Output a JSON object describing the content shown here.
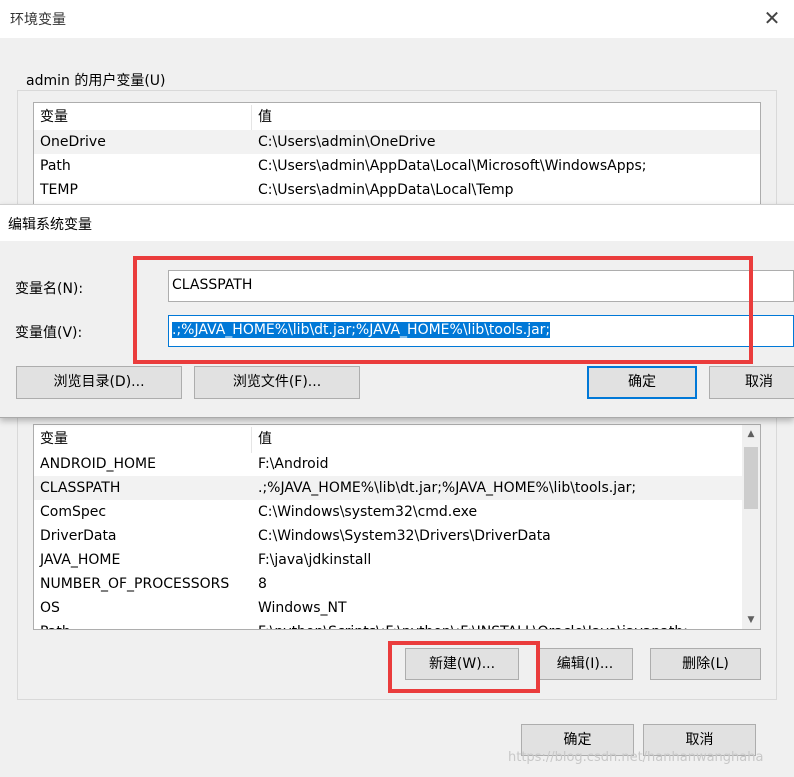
{
  "outer": {
    "title": "环境变量",
    "close_glyph": "✕",
    "user_group_label": "admin 的用户变量(U)",
    "ok_label": "确定",
    "cancel_label": "取消"
  },
  "user_vars": {
    "headers": [
      "变量",
      "值"
    ],
    "rows": [
      {
        "name": "OneDrive",
        "value": "C:\\Users\\admin\\OneDrive"
      },
      {
        "name": "Path",
        "value": "C:\\Users\\admin\\AppData\\Local\\Microsoft\\WindowsApps;"
      },
      {
        "name": "TEMP",
        "value": "C:\\Users\\admin\\AppData\\Local\\Temp"
      }
    ]
  },
  "sys_vars": {
    "headers": [
      "变量",
      "值"
    ],
    "rows": [
      {
        "name": " ANDROID_HOME",
        "value": "F:\\Android"
      },
      {
        "name": "CLASSPATH",
        "value": ".;%JAVA_HOME%\\lib\\dt.jar;%JAVA_HOME%\\lib\\tools.jar;"
      },
      {
        "name": "ComSpec",
        "value": "C:\\Windows\\system32\\cmd.exe"
      },
      {
        "name": "DriverData",
        "value": "C:\\Windows\\System32\\Drivers\\DriverData"
      },
      {
        "name": "JAVA_HOME",
        "value": "F:\\java\\jdkinstall"
      },
      {
        "name": "NUMBER_OF_PROCESSORS",
        "value": "8"
      },
      {
        "name": "OS",
        "value": "Windows_NT"
      },
      {
        "name": "Path",
        "value": "F:\\python\\Scripts\\;F:\\python\\;F:\\INSTALL\\Oracle\\Java\\javapath;..."
      }
    ],
    "selected_index": 1,
    "new_label": "新建(W)...",
    "edit_label": "编辑(I)...",
    "delete_label": "删除(L)"
  },
  "edit_dialog": {
    "title": "编辑系统变量",
    "name_label": "变量名(N):",
    "value_label": "变量值(V):",
    "name_value": "CLASSPATH",
    "value_value": ".;%JAVA_HOME%\\lib\\dt.jar;%JAVA_HOME%\\lib\\tools.jar;",
    "browse_dir_label": "浏览目录(D)...",
    "browse_file_label": "浏览文件(F)...",
    "ok_label": "确定",
    "cancel_label": "取消"
  },
  "watermark": "https://blog.csdn.net/hanhanwanghaha",
  "colors": {
    "annotation": "#ea3c3c",
    "selection": "#0078d7"
  }
}
